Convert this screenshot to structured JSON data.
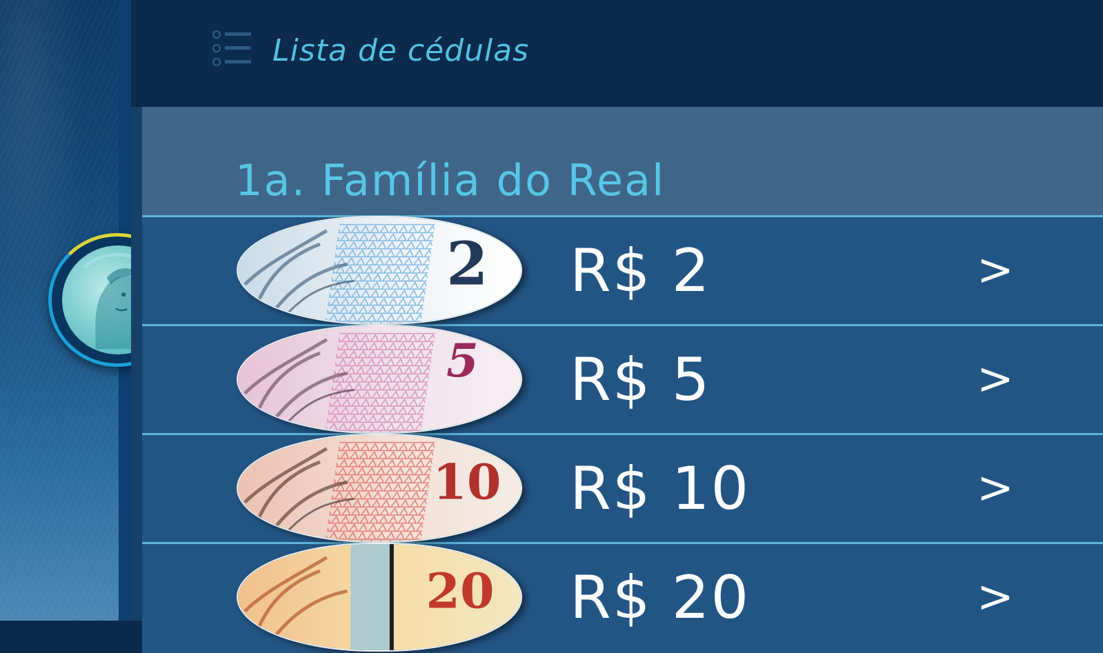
{
  "header": {
    "title": "Lista de cédulas",
    "icon": "list-icon"
  },
  "section": {
    "title": "1a. Família do Real"
  },
  "notes": [
    {
      "label": "R$ 2",
      "numeral": "2",
      "color": "#7fb3dd",
      "chevron": ">"
    },
    {
      "label": "R$ 5",
      "numeral": "5",
      "color": "#d07ab0",
      "chevron": ">"
    },
    {
      "label": "R$ 10",
      "numeral": "10",
      "color": "#e0675e",
      "chevron": ">"
    },
    {
      "label": "R$ 20",
      "numeral": "20",
      "color": "#e79a4a",
      "chevron": ">"
    }
  ],
  "colors": {
    "accent": "#53c2e2",
    "header_bg": "#0b2a4c",
    "row_bg": "#235584",
    "section_bg": "#3f6688"
  }
}
